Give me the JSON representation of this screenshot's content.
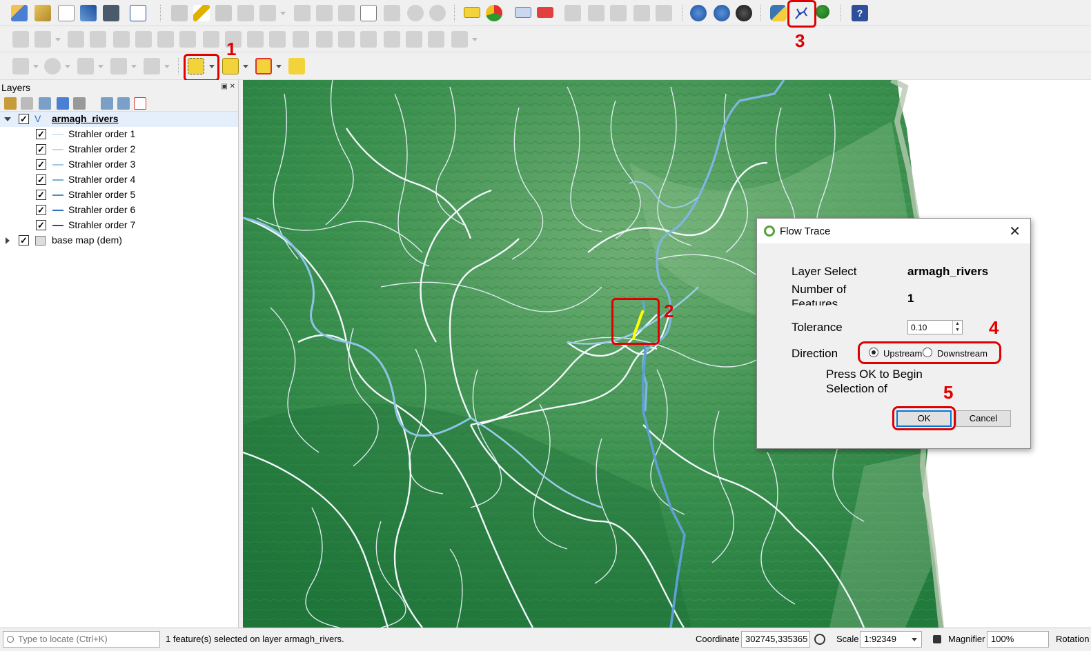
{
  "layers_panel": {
    "title": "Layers",
    "group": {
      "name": "armagh_rivers",
      "checked": true
    },
    "children": [
      {
        "label": "Strahler order 1",
        "color": "#d4e6f3"
      },
      {
        "label": "Strahler order 2",
        "color": "#bcd8ee"
      },
      {
        "label": "Strahler order 3",
        "color": "#9ec8e6"
      },
      {
        "label": "Strahler order 4",
        "color": "#72acd9"
      },
      {
        "label": "Strahler order 5",
        "color": "#4d90c8"
      },
      {
        "label": "Strahler order 6",
        "color": "#2f6fb5"
      },
      {
        "label": "Strahler order 7",
        "color": "#1c4e96"
      }
    ],
    "base_layer": {
      "name": "base map (dem)",
      "checked": true
    }
  },
  "callouts": [
    "1",
    "2",
    "3",
    "4",
    "5"
  ],
  "dialog": {
    "title": "Flow Trace",
    "layer_select_label": "Layer Select",
    "layer_select_value": "armagh_rivers",
    "num_features_label": "Number of Features",
    "num_features_value": "1",
    "tolerance_label": "Tolerance",
    "tolerance_value": "0.10",
    "direction_label": "Direction",
    "direction_options": [
      "Upstream",
      "Downstream"
    ],
    "direction_selected": "Upstream",
    "message": "Press OK to Begin Selection of",
    "ok_label": "OK",
    "cancel_label": "Cancel"
  },
  "statusbar": {
    "locate_placeholder": "Type to locate (Ctrl+K)",
    "message": "1 feature(s) selected on layer armagh_rivers.",
    "coordinate_label": "Coordinate",
    "coordinate_value": "302745,335365",
    "scale_label": "Scale",
    "scale_value": "1:92349",
    "magnifier_label": "Magnifier",
    "magnifier_value": "100%",
    "rotation_label": "Rotation"
  },
  "colors": {
    "highlight_red": "#e00000",
    "selected_feature": "#ffff00",
    "terrain_green": "#2f8a45"
  },
  "icons": [
    "open-project-icon",
    "python-console-icon",
    "flow-trace-plugin-icon",
    "identify-icon",
    "help-icon",
    "select-features-icon",
    "lock-icon",
    "cursor-target-icon",
    "search-icon"
  ]
}
